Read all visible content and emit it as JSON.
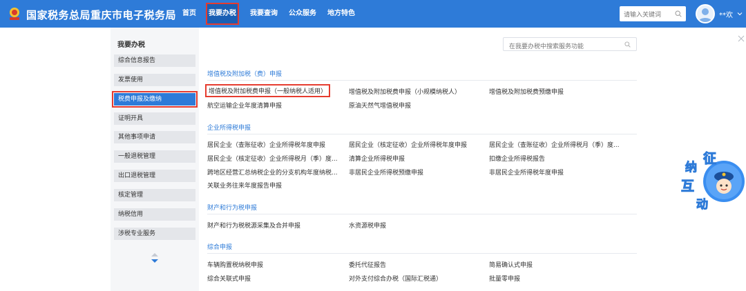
{
  "header": {
    "site_title": "国家税务总局重庆市电子税务局",
    "nav": [
      "首页",
      "我要办税",
      "我要查询",
      "公众服务",
      "地方特色"
    ],
    "search_placeholder": "请输入关键词",
    "user_name": "**欢"
  },
  "sidebar": {
    "title": "我要办税",
    "items": [
      "综合信息报告",
      "发票使用",
      "税费申报及缴纳",
      "证明开具",
      "其他事项申请",
      "一般退税管理",
      "出口退税管理",
      "核定管理",
      "纳税信用",
      "涉税专业服务"
    ],
    "active_index": 2
  },
  "main": {
    "search_placeholder": "在我要办税中搜索服务功能",
    "sections": [
      {
        "title": "增值税及附加税（费）申报",
        "links": [
          "增值税及附加税费申报（一般纳税人适用）",
          "增值税及附加税费申报（小规模纳税人）",
          "增值税及附加税费预缴申报",
          "航空运输企业年度清算申报",
          "原油天然气增值税申报"
        ]
      },
      {
        "title": "企业所得税申报",
        "links": [
          "居民企业（查账征收）企业所得税年度申报",
          "居民企业（核定征收）企业所得税年度申报",
          "居民企业（查账征收）企业所得税月（季）度...",
          "居民企业（核定征收）企业所得税月（季）度...",
          "清算企业所得税申报",
          "扣缴企业所得税报告",
          "跨地区经营汇总纳税企业的分支机构年度纳税...",
          "非居民企业所得税预缴申报",
          "非居民企业所得税年度申报",
          "关联业务往来年度报告申报"
        ]
      },
      {
        "title": "财产和行为税申报",
        "links": [
          "财产和行为税税源采集及合并申报",
          "水资源税申报"
        ]
      },
      {
        "title": "综合申报",
        "links": [
          "车辆购置税纳税申报",
          "委托代征报告",
          "简易确认式申报",
          "综合关联式申报",
          "对外支付综合办税（国际汇税通）",
          "批量零申报"
        ]
      }
    ]
  },
  "mascot": {
    "chars": [
      "纳",
      "征",
      "互",
      "动"
    ]
  },
  "colors": {
    "primary": "#2e7bd8",
    "highlight": "#e63b2e",
    "sidebar_bg": "#f5f6f8"
  }
}
